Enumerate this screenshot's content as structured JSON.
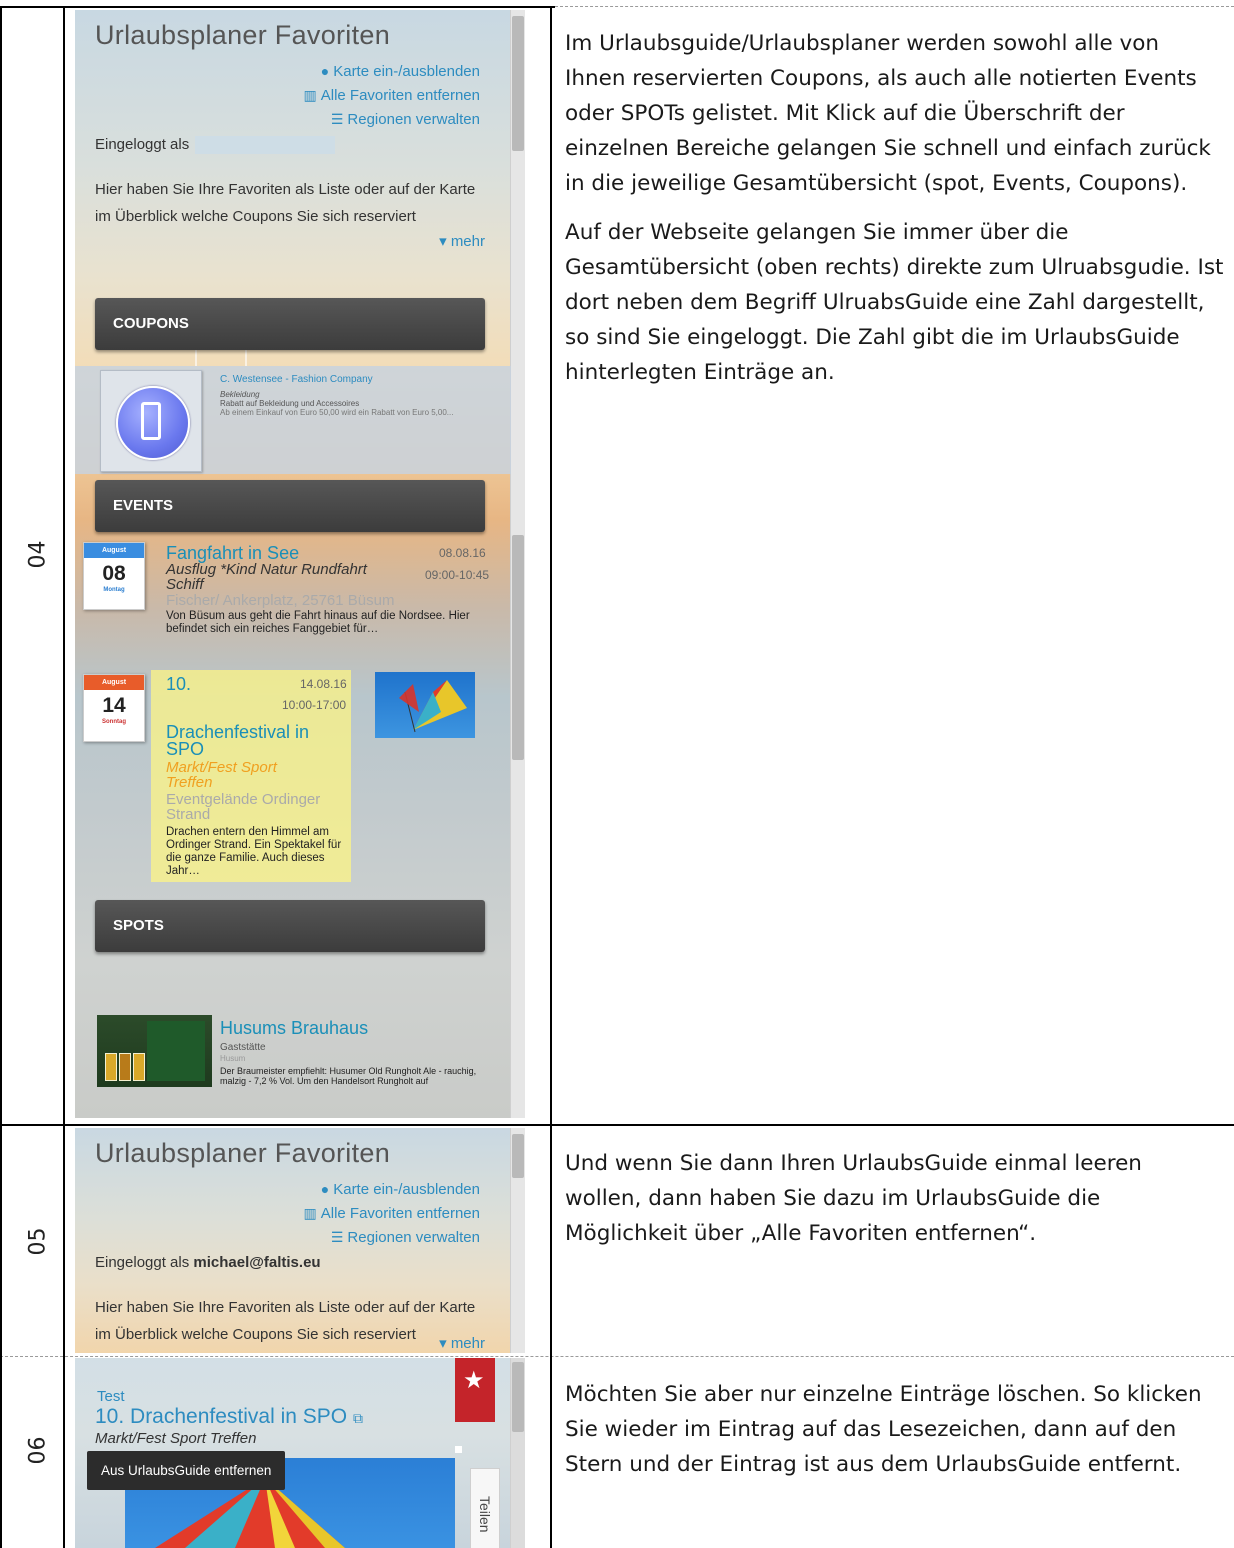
{
  "rows": [
    {
      "number": "04",
      "paragraphs": [
        "Im Urlaubsguide/Urlaubsplaner werden sowohl alle von Ihnen reservierten Coupons, als auch alle notierten Events oder SPOTs gelistet. Mit Klick auf die Überschrift der einzelnen Bereiche gelangen Sie schnell und einfach zurück in die jeweilige Gesamtübersicht (spot, Events, Coupons).",
        "Auf der Webseite gelangen Sie immer über die Gesamtübersicht (oben rechts) direkte zum Ulruabsgudie. Ist dort neben dem Begriff UlruabsGuide eine Zahl dargestellt, so sind Sie eingeloggt. Die Zahl gibt die im UrlaubsGuide hinterlegten Einträge an."
      ],
      "screenshot": {
        "title": "Urlaubsplaner Favoriten",
        "links": [
          "Karte ein-/ausblenden",
          "Alle Favoriten entfernen",
          "Regionen verwalten"
        ],
        "logged_in_label": "Eingeloggt als",
        "intro": "Hier haben Sie Ihre Favoriten als Liste oder auf der Karte im Überblick welche Coupons Sie sich reserviert",
        "more": "mehr",
        "sections": [
          "COUPONS",
          "EVENTS",
          "SPOTS"
        ],
        "coupon": {
          "company": "C. Westensee - Fashion Company",
          "category": "Bekleidung",
          "line1": "Rabatt auf Bekleidung und Accessoires",
          "line2": "Ab einem Einkauf von Euro 50,00 wird ein Rabatt von Euro 5,00..."
        },
        "events": [
          {
            "month": "August",
            "day": "08",
            "weekday": "Montag",
            "title": "Fangfahrt in See",
            "date": "08.08.16",
            "time": "09:00-10:45",
            "tags": "Ausflug *Kind Natur Rundfahrt Schiff",
            "place": "Fischer/ Ankerplatz, 25761 Büsum",
            "text": "Von Büsum aus geht die Fahrt hinaus auf die Nordsee. Hier befindet sich ein reiches Fanggebiet für…"
          },
          {
            "month": "August",
            "day": "14",
            "weekday": "Sonntag",
            "prefix": "10.",
            "title": "Drachenfestival in SPO",
            "date": "14.08.16",
            "time": "10:00-17:00",
            "tags": "Markt/Fest Sport Treffen",
            "place": "Eventgelände Ordinger Strand",
            "text": "Drachen entern den Himmel am Ordinger Strand. Ein Spektakel für die ganze Familie. Auch dieses Jahr…"
          }
        ],
        "spot": {
          "title": "Husums Brauhaus",
          "category": "Gaststätte",
          "city": "Husum",
          "text": "Der Braumeister empfiehlt: Husumer Old Rungholt Ale - rauchig, malzig - 7,2 % Vol. Um den Handelsort Rungholt auf"
        }
      }
    },
    {
      "number": "05",
      "paragraphs": [
        "Und wenn Sie dann Ihren UrlaubsGuide einmal leeren wollen, dann haben Sie dazu im UrlaubsGuide die Möglichkeit über „Alle Favoriten entfernen“."
      ],
      "screenshot": {
        "title": "Urlaubsplaner Favoriten",
        "links": [
          "Karte ein-/ausblenden",
          "Alle Favoriten entfernen",
          "Regionen verwalten"
        ],
        "logged_in_label": "Eingeloggt als",
        "logged_in_user": "michael@faltis.eu",
        "intro": "Hier haben Sie Ihre Favoriten als Liste oder auf der Karte im Überblick welche Coupons Sie sich reserviert",
        "more": "mehr"
      }
    },
    {
      "number": "06",
      "paragraphs": [
        "Möchten Sie aber nur einzelne Einträge löschen. So klicken Sie wieder im Eintrag auf das Lesezeichen, dann auf den Stern und der Eintrag ist aus dem UrlaubsGuide entfernt."
      ],
      "screenshot": {
        "kicker": "Test",
        "title": "10. Drachenfestival in SPO",
        "tags": "Markt/Fest Sport Treffen",
        "tooltip": "Aus UrlaubsGuide entfernen",
        "share": "Teilen"
      }
    }
  ],
  "colors": {
    "link": "#2d8cc0",
    "section_bar": "#454545",
    "bookmark": "#c4242a",
    "highlight": "#fff682"
  },
  "icons": {
    "map": "globe-icon",
    "remove": "trash-icon",
    "regions": "list-icon",
    "more": "caret-down-icon",
    "external": "external-link-icon",
    "star": "star-icon"
  }
}
